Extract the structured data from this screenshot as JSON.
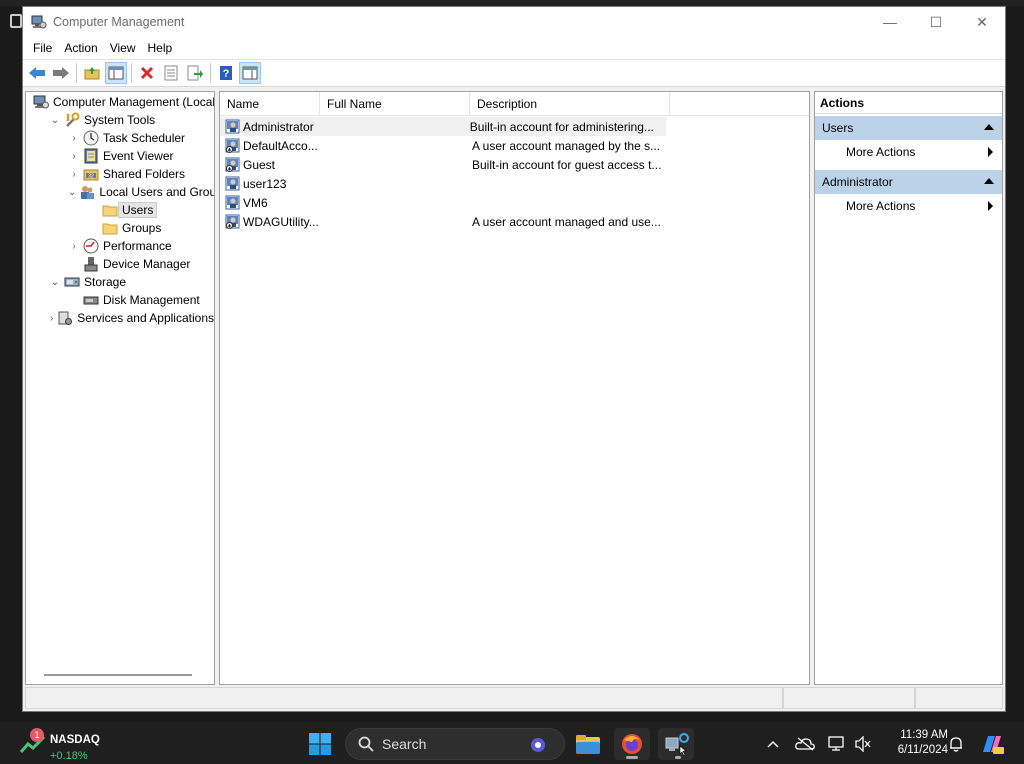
{
  "window": {
    "title": "Computer Management",
    "controls": {
      "minimize": "—",
      "maximize": "☐",
      "close": "✕"
    }
  },
  "menu": [
    "File",
    "Action",
    "View",
    "Help"
  ],
  "toolbar": [
    "back-icon",
    "forward-icon",
    "up-folder-icon",
    "show-hide-tree-icon",
    "delete-icon",
    "properties-icon",
    "export-list-icon",
    "help-icon",
    "show-hide-action-pane-icon"
  ],
  "tree": {
    "items": [
      {
        "label": "Computer Management (Local",
        "level": 0,
        "expander": "",
        "icon": "computer-management-icon"
      },
      {
        "label": "System Tools",
        "level": 1,
        "expander": "⌄",
        "icon": "tools-icon"
      },
      {
        "label": "Task Scheduler",
        "level": 2,
        "expander": "›",
        "icon": "clock-icon"
      },
      {
        "label": "Event Viewer",
        "level": 2,
        "expander": "›",
        "icon": "event-viewer-icon"
      },
      {
        "label": "Shared Folders",
        "level": 2,
        "expander": "›",
        "icon": "shared-folder-icon"
      },
      {
        "label": "Local Users and Groups",
        "level": 2,
        "expander": "⌄",
        "icon": "users-groups-icon"
      },
      {
        "label": "Users",
        "level": 3,
        "expander": "",
        "icon": "folder-icon",
        "selected": true
      },
      {
        "label": "Groups",
        "level": 3,
        "expander": "",
        "icon": "folder-icon"
      },
      {
        "label": "Performance",
        "level": 2,
        "expander": "›",
        "icon": "performance-icon"
      },
      {
        "label": "Device Manager",
        "level": 2,
        "expander": "",
        "icon": "device-manager-icon"
      },
      {
        "label": "Storage",
        "level": 1,
        "expander": "⌄",
        "icon": "storage-icon"
      },
      {
        "label": "Disk Management",
        "level": 2,
        "expander": "",
        "icon": "disk-icon"
      },
      {
        "label": "Services and Applications",
        "level": 1,
        "expander": "›",
        "icon": "services-icon"
      }
    ]
  },
  "list": {
    "columns": [
      "Name",
      "Full Name",
      "Description"
    ],
    "rows": [
      {
        "name": "Administrator",
        "full_name": "",
        "description": "Built-in account for administering...",
        "selected": true
      },
      {
        "name": "DefaultAcco...",
        "full_name": "",
        "description": "A user account managed by the s..."
      },
      {
        "name": "Guest",
        "full_name": "",
        "description": "Built-in account for guest access t..."
      },
      {
        "name": "user123",
        "full_name": "",
        "description": ""
      },
      {
        "name": "VM6",
        "full_name": "",
        "description": ""
      },
      {
        "name": "WDAGUtility...",
        "full_name": "",
        "description": "A user account managed and use..."
      }
    ]
  },
  "actions": {
    "title": "Actions",
    "groups": [
      {
        "label": "Users",
        "items": [
          "More Actions"
        ]
      },
      {
        "label": "Administrator",
        "items": [
          "More Actions"
        ]
      }
    ]
  },
  "taskbar": {
    "widget": {
      "badge": "1",
      "name": "NASDAQ",
      "change": "+0.18%"
    },
    "search_label": "Search",
    "time": "11:39 AM",
    "date": "6/11/2024"
  },
  "colors": {
    "selection": "#cce4f7",
    "action_header": "#bcd2e8",
    "taskbar": "#1f1f1f",
    "stock_up": "#4cc37a"
  }
}
